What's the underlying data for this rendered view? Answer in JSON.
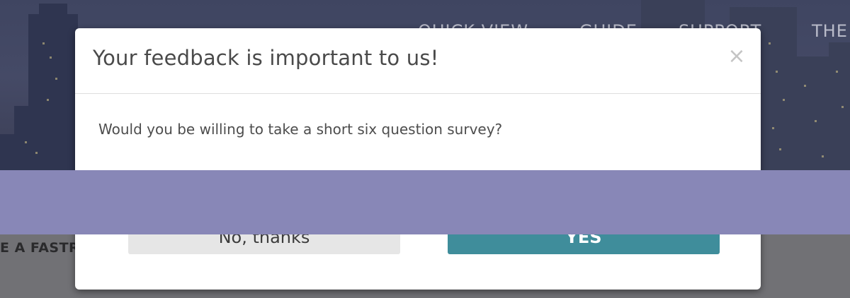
{
  "background_page": {
    "nav": {
      "items": [
        "QUICK VIEW",
        "GUIDE",
        "SUPPORT",
        "THE"
      ]
    },
    "section_text": "E A FASTR"
  },
  "modal": {
    "title": "Your feedback is important to us!",
    "close_label": "×",
    "message": "Would you be willing to take a short six question survey?",
    "decline_label": "No, thanks",
    "accept_label": "YES"
  },
  "colors": {
    "accept_button": "#3f8d9b",
    "decline_button": "#e6e6e6",
    "overlay_band": "#8887b7"
  }
}
